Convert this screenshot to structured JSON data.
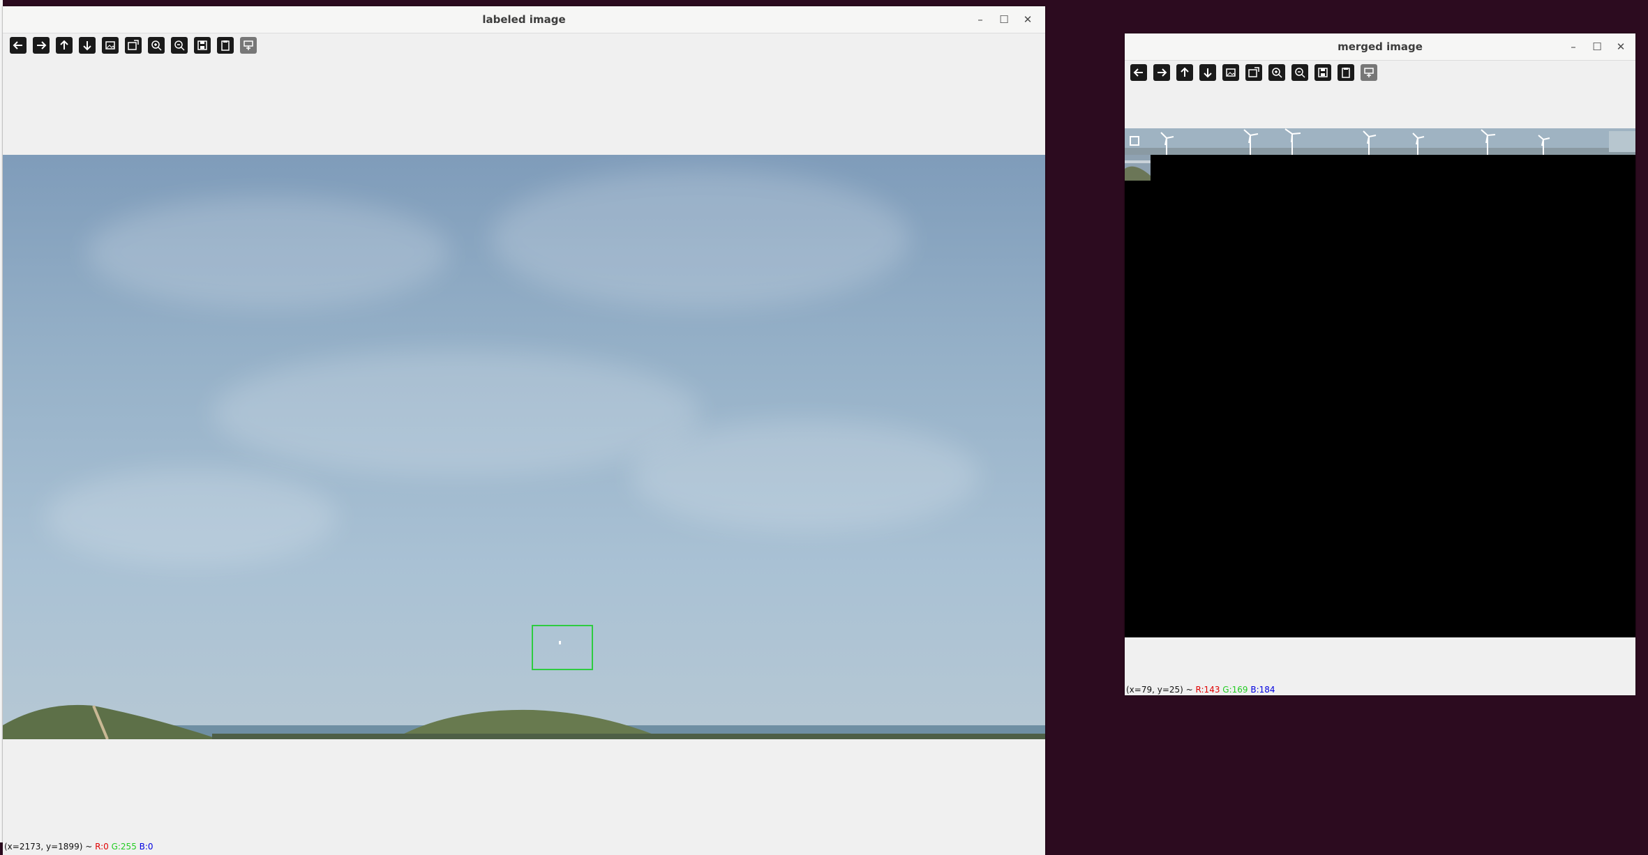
{
  "windows": {
    "labeled": {
      "title": "labeled image",
      "status": {
        "coords": "(x=2173, y=1899) ~",
        "r": "R:0",
        "g": "G:255",
        "b": "B:0"
      }
    },
    "merged": {
      "title": "merged image",
      "status": {
        "coords": "(x=79, y=25) ~",
        "r": "R:143",
        "g": "G:169",
        "b": "B:184"
      }
    }
  },
  "window_controls": {
    "minimize": "–",
    "maximize": "☐",
    "close": "✕"
  },
  "toolbar_icons": [
    "arrow-left-icon",
    "arrow-right-icon",
    "arrow-up-icon",
    "arrow-down-icon",
    "image-icon",
    "image-scale-icon",
    "zoom-in-icon",
    "zoom-out-icon",
    "save-icon",
    "clipboard-icon",
    "properties-icon"
  ],
  "colors": {
    "bbox": "#2ecc40",
    "desktop": "#2c0b1f",
    "window_bg": "#f0f0f0"
  }
}
